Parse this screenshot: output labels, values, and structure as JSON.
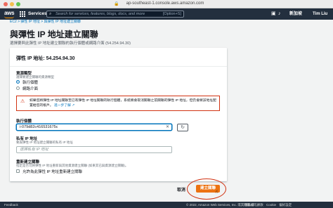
{
  "browser": {
    "url": "ap-southeast-1.console.aws.amazon.com"
  },
  "nav": {
    "logo": "aws",
    "services": "Services",
    "search_placeholder": "Search for services, features, blogs, docs, and more",
    "search_shortcut": "[Option+S]",
    "region": "新加坡",
    "user": "Tim Liu"
  },
  "breadcrumb": "EC2 > 彈性 IP 地址 > 與彈性 IP 地址建立關聯",
  "page": {
    "title": "與彈性 IP 地址建立關聯",
    "description": "選擇要與此彈性 IP 地址建立關聯的執行個體或網路介面 (54.254.94.30)"
  },
  "card": {
    "title": "彈性 IP 地址: 54.254.94.30",
    "resource_type": {
      "label": "資源類型",
      "hint": "選擇要建立關聯的資源類型",
      "options": [
        "執行個體",
        "網路介面"
      ],
      "selected": "執行個體"
    },
    "alert": {
      "text": "如果您將彈性 IP 地址關聯至已有彈性 IP 地址關聯的執行個體，系統將會取消關聯之前關聯的彈性 IP 地址，但仍會將該地址配置給您的帳戶。",
      "link": "進一步了解"
    },
    "instance": {
      "label": "執行個體",
      "value": "i-079d82c416531675c"
    },
    "private_ip": {
      "label": "私有 IP 地址",
      "hint": "要與彈性 IP 地址建立關聯的私有 IP 地址",
      "placeholder": "選擇私有 IP 地址"
    },
    "reassociation": {
      "label": "重新建立關聯",
      "hint": "指定是否可將彈性 IP 地址重新與其他資源建立關聯 (如果其已與資源建立關聯)。",
      "checkbox_label": "允許為此彈性 IP 地址重新建立關聯"
    }
  },
  "actions": {
    "cancel": "取消",
    "associate": "建立關聯"
  },
  "footer": {
    "feedback": "Feedback",
    "copyright": "© 2022, Amazon Web Services, Inc. 或其附屬公司。",
    "links": "隱私權 條款 Cookie 偏好設定"
  }
}
